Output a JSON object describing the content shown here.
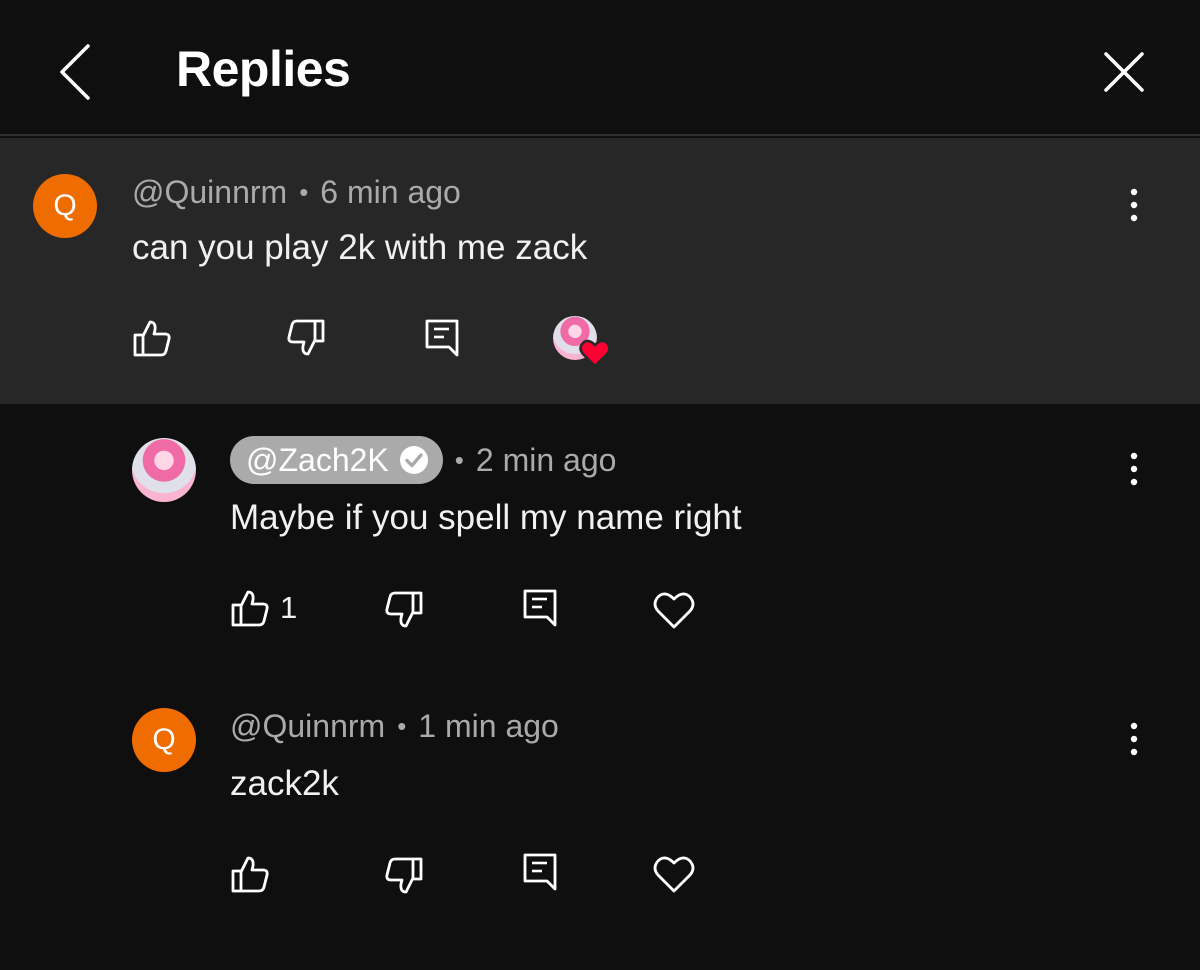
{
  "header": {
    "title": "Replies"
  },
  "comments": [
    {
      "avatar_letter": "Q",
      "handle": "@Quinnrm",
      "separator": "•",
      "time": "6 min ago",
      "text": "can you play 2k with me zack",
      "likes": "",
      "hearted_by_creator": true
    },
    {
      "avatar_letter": "",
      "handle": "@Zach2K",
      "verified": true,
      "separator": "•",
      "time": "2 min ago",
      "text": "Maybe if you spell my name right",
      "likes": "1"
    },
    {
      "avatar_letter": "Q",
      "handle": "@Quinnrm",
      "separator": "•",
      "time": "1 min ago",
      "text": "zack2k",
      "likes": ""
    }
  ],
  "colors": {
    "avatar_orange": "#ef6c00",
    "highlight_bg": "#272727",
    "heart_red": "#ff0033"
  }
}
